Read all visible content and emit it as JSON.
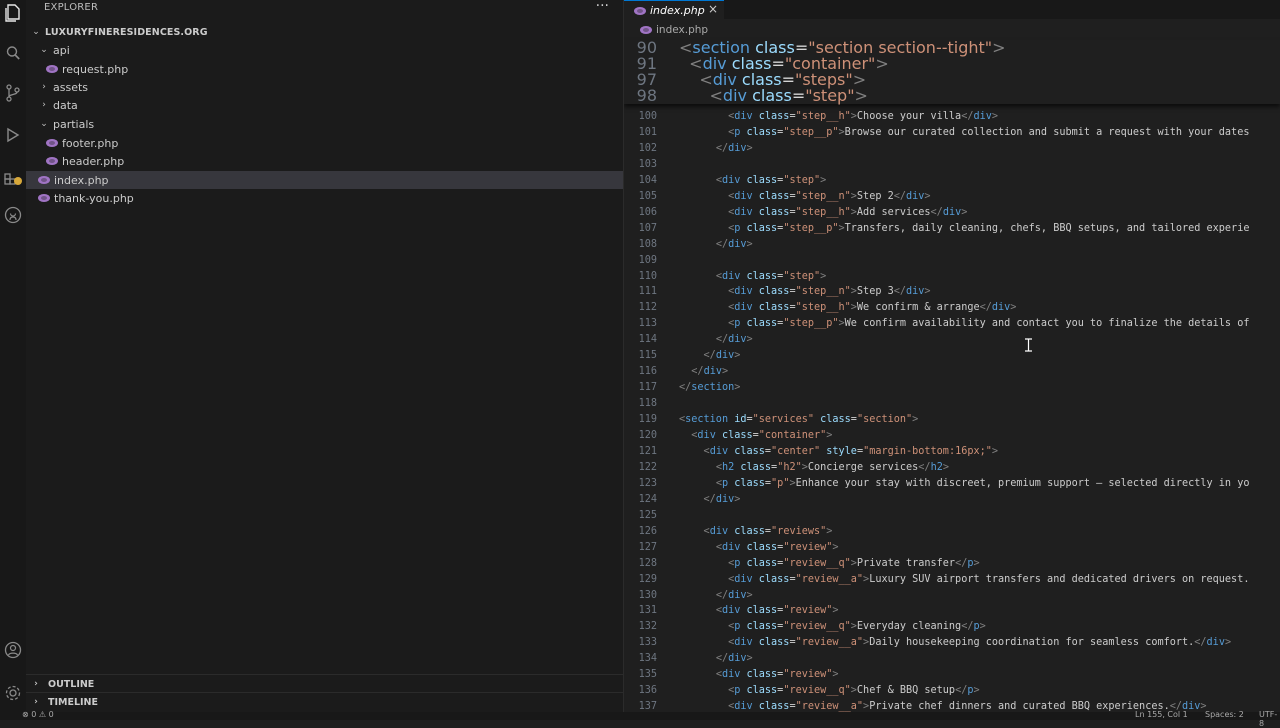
{
  "sidebar": {
    "title": "EXPLORER",
    "more": "···",
    "root": "LUXURYFINERESIDENCES.ORG",
    "items": [
      {
        "label": "api"
      },
      {
        "label": "request.php"
      },
      {
        "label": "assets"
      },
      {
        "label": "data"
      },
      {
        "label": "partials"
      },
      {
        "label": "footer.php"
      },
      {
        "label": "header.php"
      },
      {
        "label": "index.php"
      },
      {
        "label": "thank-you.php"
      }
    ],
    "outline": "OUTLINE",
    "timeline": "TIMELINE"
  },
  "activity_icons": [
    "explorer-icon",
    "search-icon",
    "source-control-icon",
    "run-debug-icon",
    "extensions-icon",
    "github-icon",
    "account-icon",
    "settings-icon"
  ],
  "editor": {
    "tab_label": "index.php",
    "tab_close": "×",
    "breadcrumb": "index.php",
    "sticky": [
      {
        "n": "90",
        "html": "<span class='p'>&lt;</span><span class='t'>section</span> <span class='a'>class</span><span class='x'>=</span><span class='s'>\"section section--tight\"</span><span class='p'>&gt;</span>"
      },
      {
        "n": "91",
        "html": "  <span class='p'>&lt;</span><span class='t'>div</span> <span class='a'>class</span><span class='x'>=</span><span class='s'>\"container\"</span><span class='p'>&gt;</span>"
      },
      {
        "n": "97",
        "html": "    <span class='p'>&lt;</span><span class='t'>div</span> <span class='a'>class</span><span class='x'>=</span><span class='s'>\"steps\"</span><span class='p'>&gt;</span>"
      },
      {
        "n": "98",
        "html": "      <span class='p'>&lt;</span><span class='t'>div</span> <span class='a'>class</span><span class='x'>=</span><span class='s'>\"step\"</span><span class='p'>&gt;</span>"
      }
    ],
    "lines": [
      {
        "n": "100",
        "html": "        <span class='p'>&lt;</span><span class='t'>div</span> <span class='a'>class</span><span class='x'>=</span><span class='s'>\"step__h\"</span><span class='p'>&gt;</span>Choose your villa<span class='p'>&lt;/</span><span class='t'>div</span><span class='p'>&gt;</span>"
      },
      {
        "n": "101",
        "html": "        <span class='p'>&lt;</span><span class='t'>p</span> <span class='a'>class</span><span class='x'>=</span><span class='s'>\"step__p\"</span><span class='p'>&gt;</span>Browse our curated collection and submit a request with your dates"
      },
      {
        "n": "102",
        "html": "      <span class='p'>&lt;/</span><span class='t'>div</span><span class='p'>&gt;</span>"
      },
      {
        "n": "103",
        "html": ""
      },
      {
        "n": "104",
        "html": "      <span class='p'>&lt;</span><span class='t'>div</span> <span class='a'>class</span><span class='x'>=</span><span class='s'>\"step\"</span><span class='p'>&gt;</span>"
      },
      {
        "n": "105",
        "html": "        <span class='p'>&lt;</span><span class='t'>div</span> <span class='a'>class</span><span class='x'>=</span><span class='s'>\"step__n\"</span><span class='p'>&gt;</span>Step 2<span class='p'>&lt;/</span><span class='t'>div</span><span class='p'>&gt;</span>"
      },
      {
        "n": "106",
        "html": "        <span class='p'>&lt;</span><span class='t'>div</span> <span class='a'>class</span><span class='x'>=</span><span class='s'>\"step__h\"</span><span class='p'>&gt;</span>Add services<span class='p'>&lt;/</span><span class='t'>div</span><span class='p'>&gt;</span>"
      },
      {
        "n": "107",
        "html": "        <span class='p'>&lt;</span><span class='t'>p</span> <span class='a'>class</span><span class='x'>=</span><span class='s'>\"step__p\"</span><span class='p'>&gt;</span>Transfers, daily cleaning, chefs, BBQ setups, and tailored experie"
      },
      {
        "n": "108",
        "html": "      <span class='p'>&lt;/</span><span class='t'>div</span><span class='p'>&gt;</span>"
      },
      {
        "n": "109",
        "html": ""
      },
      {
        "n": "110",
        "html": "      <span class='p'>&lt;</span><span class='t'>div</span> <span class='a'>class</span><span class='x'>=</span><span class='s'>\"step\"</span><span class='p'>&gt;</span>"
      },
      {
        "n": "111",
        "html": "        <span class='p'>&lt;</span><span class='t'>div</span> <span class='a'>class</span><span class='x'>=</span><span class='s'>\"step__n\"</span><span class='p'>&gt;</span>Step 3<span class='p'>&lt;/</span><span class='t'>div</span><span class='p'>&gt;</span>"
      },
      {
        "n": "112",
        "html": "        <span class='p'>&lt;</span><span class='t'>div</span> <span class='a'>class</span><span class='x'>=</span><span class='s'>\"step__h\"</span><span class='p'>&gt;</span>We confirm &amp; arrange<span class='p'>&lt;/</span><span class='t'>div</span><span class='p'>&gt;</span>"
      },
      {
        "n": "113",
        "html": "        <span class='p'>&lt;</span><span class='t'>p</span> <span class='a'>class</span><span class='x'>=</span><span class='s'>\"step__p\"</span><span class='p'>&gt;</span>We confirm availability and contact you to finalize the details of"
      },
      {
        "n": "114",
        "html": "      <span class='p'>&lt;/</span><span class='t'>div</span><span class='p'>&gt;</span>"
      },
      {
        "n": "115",
        "html": "    <span class='p'>&lt;/</span><span class='t'>div</span><span class='p'>&gt;</span>"
      },
      {
        "n": "116",
        "html": "  <span class='p'>&lt;/</span><span class='t'>div</span><span class='p'>&gt;</span>"
      },
      {
        "n": "117",
        "html": "<span class='p'>&lt;/</span><span class='t'>section</span><span class='p'>&gt;</span>"
      },
      {
        "n": "118",
        "html": ""
      },
      {
        "n": "119",
        "html": "<span class='p'>&lt;</span><span class='t'>section</span> <span class='a'>id</span><span class='x'>=</span><span class='s'>\"services\"</span> <span class='a'>class</span><span class='x'>=</span><span class='s'>\"section\"</span><span class='p'>&gt;</span>"
      },
      {
        "n": "120",
        "html": "  <span class='p'>&lt;</span><span class='t'>div</span> <span class='a'>class</span><span class='x'>=</span><span class='s'>\"container\"</span><span class='p'>&gt;</span>"
      },
      {
        "n": "121",
        "html": "    <span class='p'>&lt;</span><span class='t'>div</span> <span class='a'>class</span><span class='x'>=</span><span class='s'>\"center\"</span> <span class='a'>style</span><span class='x'>=</span><span class='s'>\"margin-bottom:16px;\"</span><span class='p'>&gt;</span>"
      },
      {
        "n": "122",
        "html": "      <span class='p'>&lt;</span><span class='t'>h2</span> <span class='a'>class</span><span class='x'>=</span><span class='s'>\"h2\"</span><span class='p'>&gt;</span>Concierge services<span class='p'>&lt;/</span><span class='t'>h2</span><span class='p'>&gt;</span>"
      },
      {
        "n": "123",
        "html": "      <span class='p'>&lt;</span><span class='t'>p</span> <span class='a'>class</span><span class='x'>=</span><span class='s'>\"p\"</span><span class='p'>&gt;</span>Enhance your stay with discreet, premium support — selected directly in yo"
      },
      {
        "n": "124",
        "html": "    <span class='p'>&lt;/</span><span class='t'>div</span><span class='p'>&gt;</span>"
      },
      {
        "n": "125",
        "html": ""
      },
      {
        "n": "126",
        "html": "    <span class='p'>&lt;</span><span class='t'>div</span> <span class='a'>class</span><span class='x'>=</span><span class='s'>\"reviews\"</span><span class='p'>&gt;</span>"
      },
      {
        "n": "127",
        "html": "      <span class='p'>&lt;</span><span class='t'>div</span> <span class='a'>class</span><span class='x'>=</span><span class='s'>\"review\"</span><span class='p'>&gt;</span>"
      },
      {
        "n": "128",
        "html": "        <span class='p'>&lt;</span><span class='t'>p</span> <span class='a'>class</span><span class='x'>=</span><span class='s'>\"review__q\"</span><span class='p'>&gt;</span>Private transfer<span class='p'>&lt;/</span><span class='t'>p</span><span class='p'>&gt;</span>"
      },
      {
        "n": "129",
        "html": "        <span class='p'>&lt;</span><span class='t'>div</span> <span class='a'>class</span><span class='x'>=</span><span class='s'>\"review__a\"</span><span class='p'>&gt;</span>Luxury SUV airport transfers and dedicated drivers on request."
      },
      {
        "n": "130",
        "html": "      <span class='p'>&lt;/</span><span class='t'>div</span><span class='p'>&gt;</span>"
      },
      {
        "n": "131",
        "html": "      <span class='p'>&lt;</span><span class='t'>div</span> <span class='a'>class</span><span class='x'>=</span><span class='s'>\"review\"</span><span class='p'>&gt;</span>"
      },
      {
        "n": "132",
        "html": "        <span class='p'>&lt;</span><span class='t'>p</span> <span class='a'>class</span><span class='x'>=</span><span class='s'>\"review__q\"</span><span class='p'>&gt;</span>Everyday cleaning<span class='p'>&lt;/</span><span class='t'>p</span><span class='p'>&gt;</span>"
      },
      {
        "n": "133",
        "html": "        <span class='p'>&lt;</span><span class='t'>div</span> <span class='a'>class</span><span class='x'>=</span><span class='s'>\"review__a\"</span><span class='p'>&gt;</span>Daily housekeeping coordination for seamless comfort.<span class='p'>&lt;/</span><span class='t'>div</span><span class='p'>&gt;</span>"
      },
      {
        "n": "134",
        "html": "      <span class='p'>&lt;/</span><span class='t'>div</span><span class='p'>&gt;</span>"
      },
      {
        "n": "135",
        "html": "      <span class='p'>&lt;</span><span class='t'>div</span> <span class='a'>class</span><span class='x'>=</span><span class='s'>\"review\"</span><span class='p'>&gt;</span>"
      },
      {
        "n": "136",
        "html": "        <span class='p'>&lt;</span><span class='t'>p</span> <span class='a'>class</span><span class='x'>=</span><span class='s'>\"review__q\"</span><span class='p'>&gt;</span>Chef &amp; BBQ setup<span class='p'>&lt;/</span><span class='t'>p</span><span class='p'>&gt;</span>"
      },
      {
        "n": "137",
        "html": "        <span class='p'>&lt;</span><span class='t'>div</span> <span class='a'>class</span><span class='x'>=</span><span class='s'>\"review__a\"</span><span class='p'>&gt;</span>Private chef dinners and curated BBQ experiences.<span class='p'>&lt;/</span><span class='t'>div</span><span class='p'>&gt;</span>"
      }
    ]
  },
  "statusbar": {
    "problems": "⊗ 0  ⚠ 0",
    "position": "Ln 155, Col 1",
    "spaces": "Spaces: 2",
    "encoding": "UTF-8"
  }
}
